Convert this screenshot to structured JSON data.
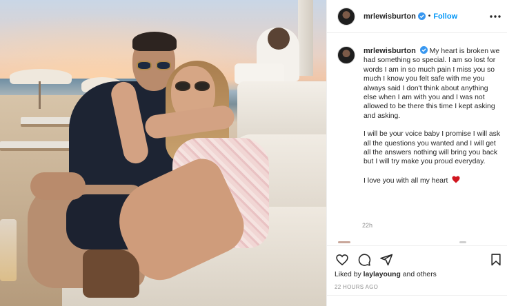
{
  "post": {
    "username": "mrlewisburton",
    "verified": true,
    "separator": "•",
    "follow_label": "Follow",
    "more_icon": "more-horizontal-icon"
  },
  "caption": {
    "username": "mrlewisburton",
    "paragraphs": [
      "My heart is broken we had something so special. I am so lost for words I am in so much pain I miss you so much I know you felt safe with me you always said I don't think about anything else when I am with you and I was not allowed to be there this time I kept asking and asking.",
      "I will be your voice baby I promise I will ask all the questions you wanted and I will get all the answers nothing will bring you back but I will try make you proud everyday.",
      "I love you with all my heart"
    ],
    "emoji": "red-heart",
    "time": "22h"
  },
  "actions": {
    "like_icon": "heart-outline-icon",
    "comment_icon": "comment-bubble-icon",
    "share_icon": "paper-plane-icon",
    "save_icon": "bookmark-icon"
  },
  "likes": {
    "prefix": "Liked by",
    "user": "laylayoung",
    "suffix": "and others"
  },
  "timestamp": "22 HOURS AGO",
  "colors": {
    "accent": "#0095f6",
    "heart": "#ed4956",
    "verified": "#3897f0",
    "text": "#262626",
    "muted": "#8e8e8e"
  }
}
